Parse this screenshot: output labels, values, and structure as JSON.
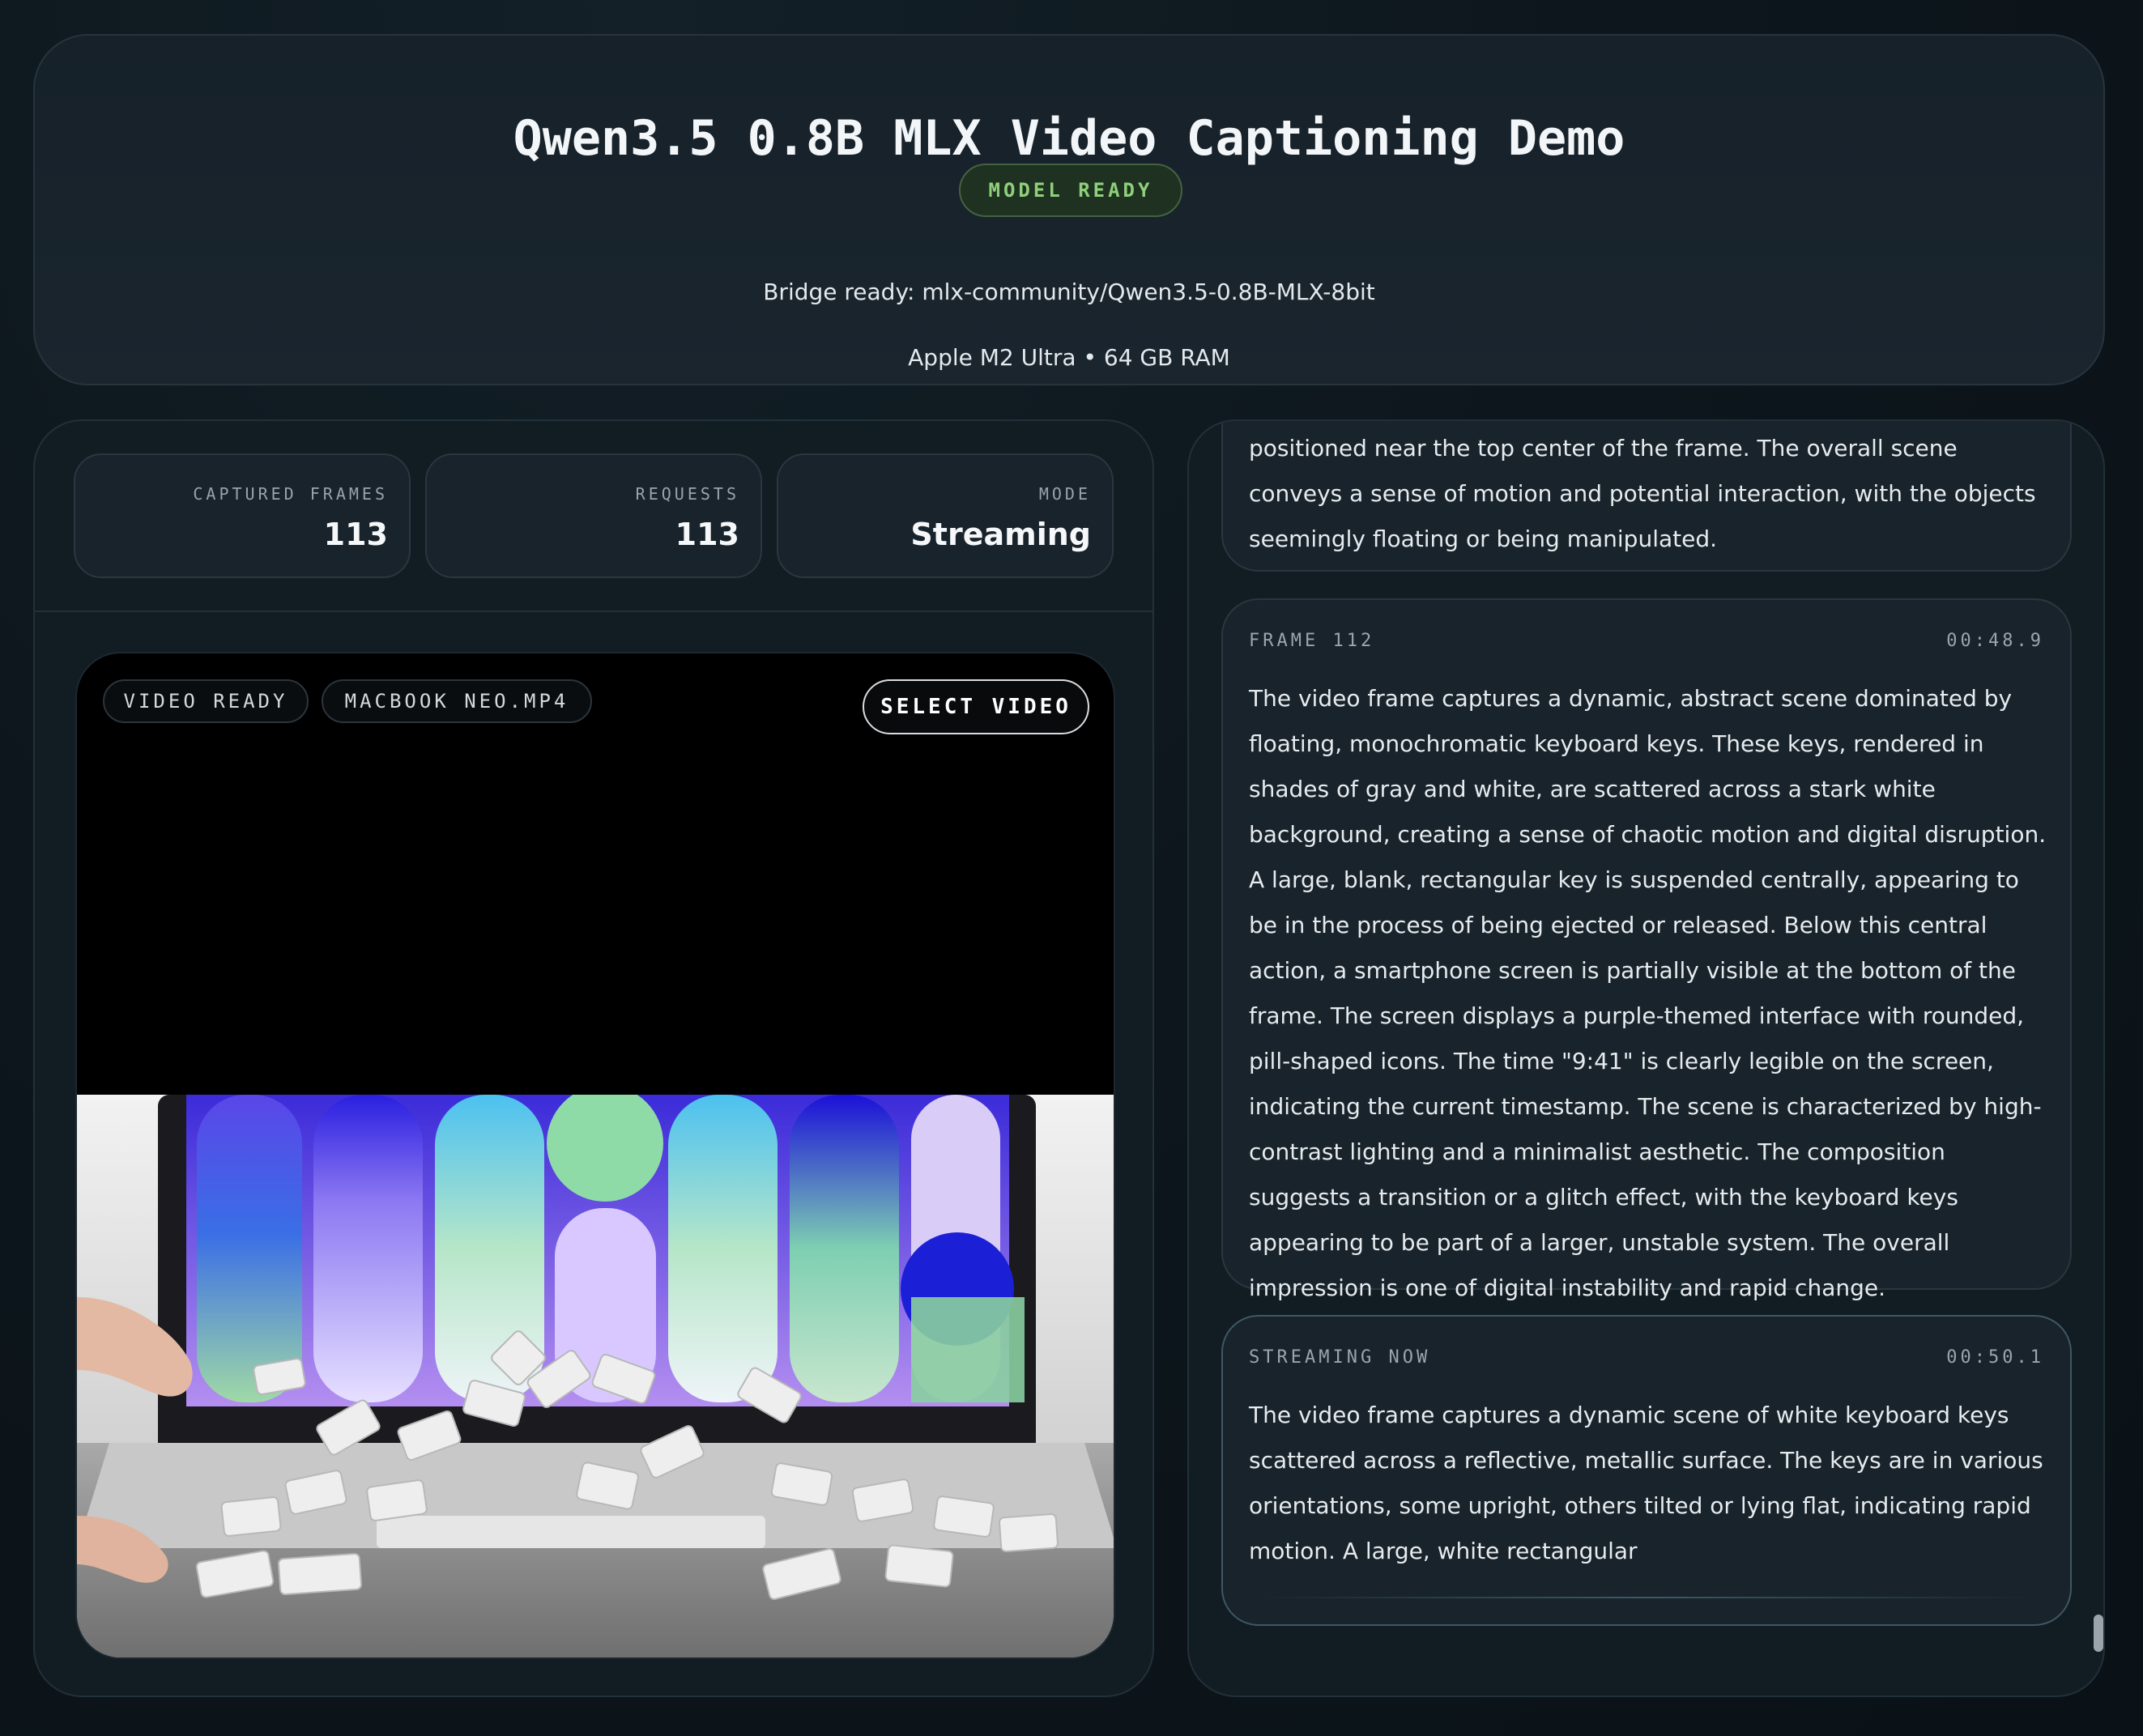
{
  "header": {
    "title": "Qwen3.5 0.8B MLX Video Captioning Demo",
    "status_badge": "MODEL READY",
    "bridge_text": "Bridge ready: mlx-community/Qwen3.5-0.8B-MLX-8bit",
    "hardware_text": "Apple M2 Ultra • 64 GB RAM"
  },
  "stats": [
    {
      "label": "CAPTURED FRAMES",
      "value": "113"
    },
    {
      "label": "REQUESTS",
      "value": "113"
    },
    {
      "label": "MODE",
      "value": "Streaming"
    }
  ],
  "player": {
    "status_chip": "VIDEO READY",
    "file_chip": "MACBOOK NEO.MP4",
    "select_button": "SELECT VIDEO"
  },
  "captions": {
    "previous_tail": "positioned near the top center of the frame. The overall scene conveys a sense of motion and potential interaction, with the objects seemingly floating or being manipulated.",
    "frame": {
      "label": "FRAME 112",
      "timestamp": "00:48.9",
      "text": "The video frame captures a dynamic, abstract scene dominated by floating, monochromatic keyboard keys. These keys, rendered in shades of gray and white, are scattered across a stark white background, creating a sense of chaotic motion and digital disruption. A large, blank, rectangular key is suspended centrally, appearing to be in the process of being ejected or released. Below this central action, a smartphone screen is partially visible at the bottom of the frame. The screen displays a purple-themed interface with rounded, pill-shaped icons. The time \"9:41\" is clearly legible on the screen, indicating the current timestamp. The scene is characterized by high-contrast lighting and a minimalist aesthetic. The composition suggests a transition or a glitch effect, with the keyboard keys appearing to be part of a larger, unstable system. The overall impression is one of digital instability and rapid change."
    },
    "streaming": {
      "label": "STREAMING NOW",
      "timestamp": "00:50.1",
      "text": "The video frame captures a dynamic scene of white keyboard keys scattered across a reflective, metallic surface. The keys are in various orientations, some upright, others tilted or lying flat, indicating rapid motion. A large, white rectangular"
    }
  },
  "colors": {
    "accent_green": "#8fd07a",
    "panel_bg": "#121c23",
    "card_bg": "#18232b"
  }
}
